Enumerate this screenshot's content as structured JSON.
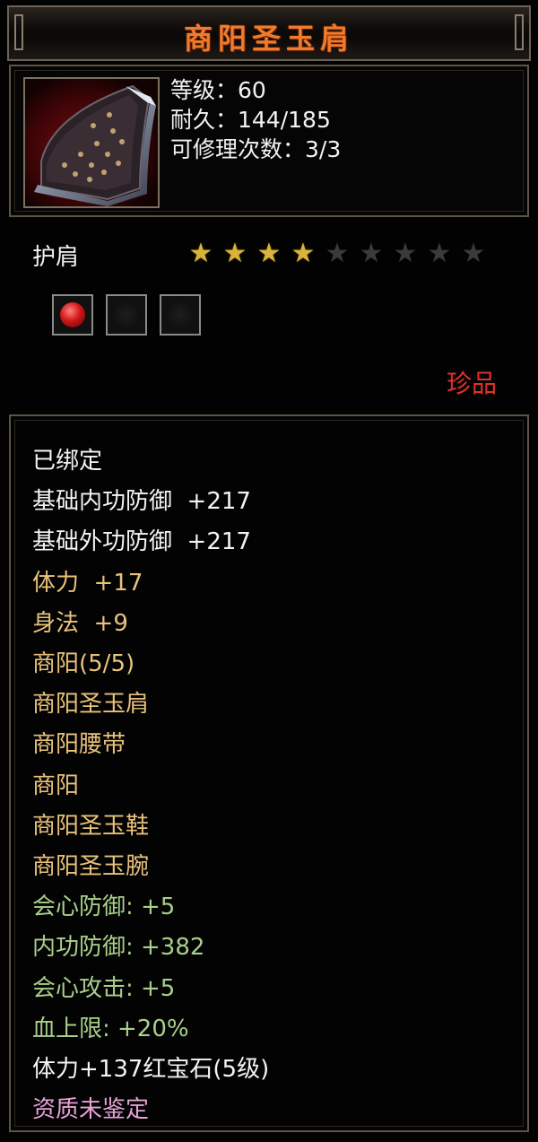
{
  "item": {
    "name": "商阳圣玉肩",
    "level_text": "等级：60",
    "durability_text": "耐久：144/185",
    "repair_text": "可修理次数：3/3",
    "type": "护肩",
    "rarity": "珍品",
    "stars_filled": 4,
    "stars_total": 9,
    "sockets": [
      "ruby",
      "empty",
      "empty"
    ],
    "icon": "shoulder-armor-icon"
  },
  "colors": {
    "title": "#f07a2e",
    "rarity": "#e2302a",
    "star_on": "#d8b43a",
    "white": "#f4f4f4",
    "gold": "#e9c27a",
    "green": "#a8d08a",
    "pink": "#e6a2d6"
  },
  "attributes": [
    {
      "text": "已绑定",
      "color": "white"
    },
    {
      "text": "基础内功防御  +217",
      "color": "white"
    },
    {
      "text": "基础外功防御  +217",
      "color": "white"
    },
    {
      "text": "体力  +17",
      "color": "gold"
    },
    {
      "text": "身法  +9",
      "color": "gold"
    },
    {
      "text": "商阳(5/5)",
      "color": "gold"
    },
    {
      "text": "商阳圣玉肩",
      "color": "gold"
    },
    {
      "text": "商阳腰带",
      "color": "gold"
    },
    {
      "text": "商阳",
      "color": "gold"
    },
    {
      "text": "商阳圣玉鞋",
      "color": "gold"
    },
    {
      "text": "商阳圣玉腕",
      "color": "gold"
    },
    {
      "text": "会心防御: +5",
      "color": "green"
    },
    {
      "text": "内功防御: +382",
      "color": "green"
    },
    {
      "text": "会心攻击: +5",
      "color": "green"
    },
    {
      "text": "血上限: +20%",
      "color": "green"
    },
    {
      "text": "体力+137红宝石(5级)",
      "color": "white"
    },
    {
      "text": "资质未鉴定",
      "color": "pink"
    }
  ]
}
